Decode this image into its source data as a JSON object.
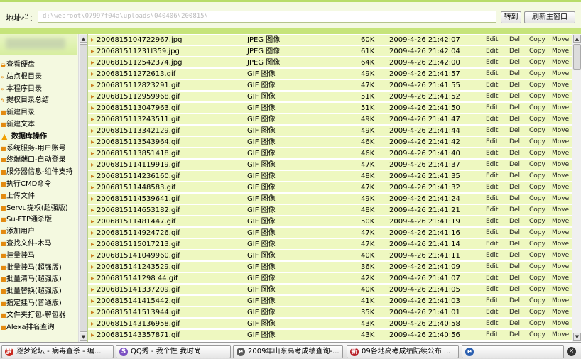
{
  "address_bar": {
    "label": "地址栏：",
    "url": "d:\\webroot\\07997f04a\\uploads\\040406\\200815\\",
    "go_label": "转到",
    "refresh_label": "刷新主窗口"
  },
  "sidebar": {
    "items": [
      {
        "label": "查看硬盘",
        "icon": "hard-disk-icon",
        "head": false
      },
      {
        "label": "站点根目录",
        "icon": "arrow-icon",
        "head": false
      },
      {
        "label": "本程序目录",
        "icon": "arrow-icon",
        "head": false
      },
      {
        "label": "提权目录总结",
        "icon": "lightning-icon",
        "head": false
      },
      {
        "label": "新建目录",
        "icon": "square-icon",
        "head": false
      },
      {
        "label": "新建文本",
        "icon": "square-icon",
        "head": false
      },
      {
        "label": "数据库操作",
        "icon": "warning-icon",
        "head": true
      },
      {
        "label": "系统服务-用户账号",
        "icon": "square-icon",
        "head": false
      },
      {
        "label": "终端端口-自动登录",
        "icon": "square-icon",
        "head": false
      },
      {
        "label": "服务器信息-组件支持",
        "icon": "square-icon",
        "head": false
      },
      {
        "label": "执行CMD命令",
        "icon": "square-icon",
        "head": false
      },
      {
        "label": "上传文件",
        "icon": "square-icon",
        "head": false
      },
      {
        "label": "Servu提权(超强版)",
        "icon": "square-icon",
        "head": false
      },
      {
        "label": "Su-FTP通杀版",
        "icon": "square-icon",
        "head": false
      },
      {
        "label": "添加用户",
        "icon": "square-icon",
        "head": false
      },
      {
        "label": "查找文件-木马",
        "icon": "square-icon",
        "head": false
      },
      {
        "label": "挂量挂马",
        "icon": "square-icon",
        "head": false
      },
      {
        "label": "批量挂马(超强版)",
        "icon": "square-icon",
        "head": false
      },
      {
        "label": "批量清马(超强版)",
        "icon": "square-icon",
        "head": false
      },
      {
        "label": "批量替换(超强版)",
        "icon": "square-icon",
        "head": false
      },
      {
        "label": "指定挂马(普通版)",
        "icon": "square-icon",
        "head": false
      },
      {
        "label": "文件夹打包-解包器",
        "icon": "square-icon",
        "head": false
      },
      {
        "label": "Alexa排名查询",
        "icon": "square-icon",
        "head": false
      }
    ]
  },
  "file_actions": {
    "edit": "Edit",
    "del": "Del",
    "copy": "Copy",
    "move": "Move"
  },
  "files": [
    {
      "name": "2006815104722967.jpg",
      "type": "JPEG 图像",
      "size": "60K",
      "date": "2009-4-26 21:42:07"
    },
    {
      "name": "200681511231l359.jpg",
      "type": "JPEG 图像",
      "size": "61K",
      "date": "2009-4-26 21:42:04"
    },
    {
      "name": "2006815112542374.jpg",
      "type": "JPEG 图像",
      "size": "64K",
      "date": "2009-4-26 21:42:00"
    },
    {
      "name": "200681511272613.gif",
      "type": "GIF 图像",
      "size": "49K",
      "date": "2009-4-26 21:41:57"
    },
    {
      "name": "2006815112823291.gif",
      "type": "GIF 图像",
      "size": "47K",
      "date": "2009-4-26 21:41:55"
    },
    {
      "name": "2006815112959968.gif",
      "type": "GIF 图像",
      "size": "51K",
      "date": "2009-4-26 21:41:52"
    },
    {
      "name": "2006815113047963.gif",
      "type": "GIF 图像",
      "size": "51K",
      "date": "2009-4-26 21:41:50"
    },
    {
      "name": "2006815113243511.gif",
      "type": "GIF 图像",
      "size": "49K",
      "date": "2009-4-26 21:41:47"
    },
    {
      "name": "2006815113342129.gif",
      "type": "GIF 图像",
      "size": "49K",
      "date": "2009-4-26 21:41:44"
    },
    {
      "name": "2006815113543964.gif",
      "type": "GIF 图像",
      "size": "46K",
      "date": "2009-4-26 21:41:42"
    },
    {
      "name": "2006815113851418.gif",
      "type": "GIF 图像",
      "size": "46K",
      "date": "2009-4-26 21:41:40"
    },
    {
      "name": "2006815114119919.gif",
      "type": "GIF 图像",
      "size": "47K",
      "date": "2009-4-26 21:41:37"
    },
    {
      "name": "2006815114236160.gif",
      "type": "GIF 图像",
      "size": "48K",
      "date": "2009-4-26 21:41:35"
    },
    {
      "name": "200681511448583.gif",
      "type": "GIF 图像",
      "size": "47K",
      "date": "2009-4-26 21:41:32"
    },
    {
      "name": "2006815114539641.gif",
      "type": "GIF 图像",
      "size": "49K",
      "date": "2009-4-26 21:41:24"
    },
    {
      "name": "2006815114653182.gif",
      "type": "GIF 图像",
      "size": "48K",
      "date": "2009-4-26 21:41:21"
    },
    {
      "name": "200681511481447.gif",
      "type": "GIF 图像",
      "size": "50K",
      "date": "2009-4-26 21:41:19"
    },
    {
      "name": "2006815114924726.gif",
      "type": "GIF 图像",
      "size": "47K",
      "date": "2009-4-26 21:41:16"
    },
    {
      "name": "2006815115017213.gif",
      "type": "GIF 图像",
      "size": "47K",
      "date": "2009-4-26 21:41:14"
    },
    {
      "name": "2006815141049960.gif",
      "type": "GIF 图像",
      "size": "40K",
      "date": "2009-4-26 21:41:11"
    },
    {
      "name": "2006815141243529.gif",
      "type": "GIF 图像",
      "size": "36K",
      "date": "2009-4-26 21:41:09"
    },
    {
      "name": "2006815141298 44.gif",
      "type": "GIF 图像",
      "size": "42K",
      "date": "2009-4-26 21:41:07"
    },
    {
      "name": "2006815141337209.gif",
      "type": "GIF 图像",
      "size": "40K",
      "date": "2009-4-26 21:41:05"
    },
    {
      "name": "2006815141415442.gif",
      "type": "GIF 图像",
      "size": "41K",
      "date": "2009-4-26 21:41:03"
    },
    {
      "name": "2006815141513944.gif",
      "type": "GIF 图像",
      "size": "35K",
      "date": "2009-4-26 21:41:01"
    },
    {
      "name": "2006815143136958.gif",
      "type": "GIF 图像",
      "size": "43K",
      "date": "2009-4-26 21:40:58"
    },
    {
      "name": "2006815143357871.gif",
      "type": "GIF 图像",
      "size": "43K",
      "date": "2009-4-26 21:40:56"
    }
  ],
  "taskbar": {
    "items": [
      {
        "label": "逐梦论坛 - 病毒查杀 - 编...",
        "icon": "forum-icon",
        "color": "#c8281e",
        "glyph": "梦"
      },
      {
        "label": "QQ秀 - 我个性 我时尚",
        "icon": "qq-show-icon",
        "color": "#7b4fc2",
        "glyph": "S"
      },
      {
        "label": "2009年山东高考成绩查询-...",
        "icon": "ie-page-icon",
        "color": "#5a5a5a",
        "glyph": "e"
      },
      {
        "label": "09各地高考成绩陆续公布 ...",
        "icon": "news-icon",
        "color": "#b8222a",
        "glyph": "新"
      },
      {
        "label": "",
        "icon": "browser-window-icon",
        "color": "#2b5fb0",
        "glyph": "e"
      }
    ],
    "close_glyph": "×"
  },
  "colors": {
    "accent": "#c6e47a",
    "row_bg": "#eef8c0",
    "sidebar_bg": "#f4f9e0"
  }
}
